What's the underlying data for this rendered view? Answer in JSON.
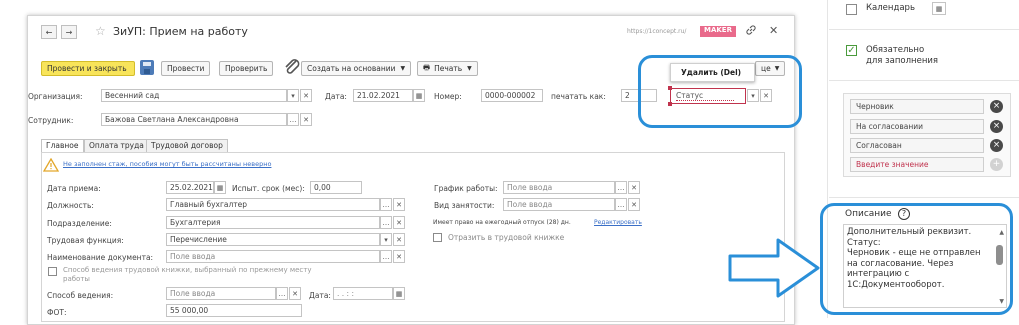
{
  "window": {
    "title": "ЗиУП: Прием на работу",
    "url": "https://1concept.ru/",
    "brand": "MAKER",
    "close_glyph": "✕",
    "link_glyph": "🔗",
    "star_glyph": "☆",
    "back_glyph": "←",
    "fwd_glyph": "→"
  },
  "toolbar": {
    "post_close": "Провести и закрыть",
    "post": "Провести",
    "check": "Проверить",
    "create_based": "Создать на основании",
    "print": "Печать",
    "more_suffix": "це"
  },
  "popup": {
    "delete_label": "Удалить (Del)",
    "status_placeholder": "Статус"
  },
  "header": {
    "org_label": "Организация:",
    "org_value": "Весенний сад",
    "date_label": "Дата:",
    "date_value": "21.02.2021",
    "number_label": "Номер:",
    "number_value": "0000-000002",
    "print_as_label": "печатать как:",
    "print_as_value": "2",
    "employee_label": "Сотрудник:",
    "employee_value": "Бажова Светлана Александровна"
  },
  "tabs": [
    "Главное",
    "Оплата труда",
    "Трудовой договор"
  ],
  "warning": "Не заполнен стаж, пособия могут быть рассчитаны неверно",
  "form": {
    "hire_date_label": "Дата приема:",
    "hire_date_value": "25.02.2021",
    "trial_label": "Испыт. срок (мес):",
    "trial_value": "0,00",
    "schedule_label": "График работы:",
    "schedule_value": "Поле ввода",
    "position_label": "Должность:",
    "position_value": "Главный бухгалтер",
    "employment_label": "Вид занятости:",
    "employment_value": "Поле ввода",
    "department_label": "Подразделение:",
    "department_value": "Бухгалтерия",
    "vacation_text": "Имеет право на ежегодный отпуск (28) дн.",
    "vacation_edit": "Редактировать",
    "function_label": "Трудовая функция:",
    "function_value": "Перечисление",
    "reflect_label": "Отразить в трудовой книжке",
    "docname_label": "Наименование документа:",
    "docname_value": "Поле ввода",
    "keep_method_line1": "Способ ведения трудовой книжки, выбранный по прежнему месту",
    "keep_method_line2": "работы",
    "method_label": "Способ ведения:",
    "method_value": "Поле ввода",
    "method_date_label": "Дата:",
    "method_date_value": ". . : :",
    "fot_label": "ФОТ:",
    "fot_value": "55 000,00"
  },
  "right_panel": {
    "calendar_label": "Календарь",
    "required_label_line1": "Обязательно",
    "required_label_line2": "для заполнения",
    "values": [
      "Черновик",
      "На согласовании",
      "Согласован"
    ],
    "enter_value": "Введите значение",
    "description_label": "Описание",
    "description_text": "Дополнительный реквизит. Статус:\nЧерновик - еще не отправлен на согласование. Через интеграцию с 1С:Документооборот."
  },
  "colors": {
    "highlight_blue": "#2a8fd8",
    "accent_red": "#c0334d",
    "brand_pink": "#e96a8b",
    "yellow_btn": "#f8e45a",
    "link_blue": "#3a6fc7"
  }
}
